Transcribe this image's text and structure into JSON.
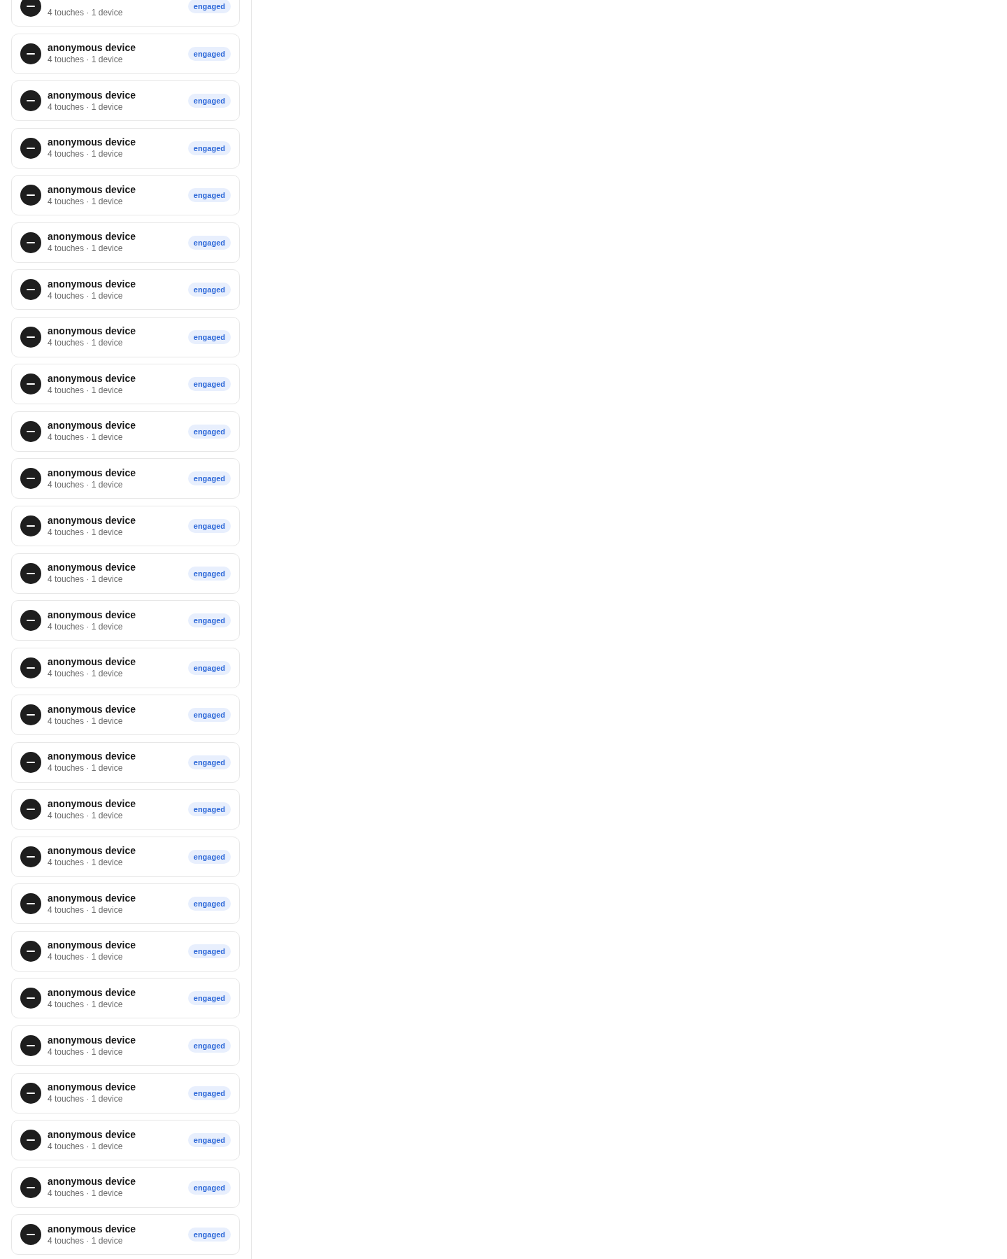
{
  "device_list": {
    "items": [
      {
        "subtitle": "4 touches · 1 device",
        "status": "engaged"
      },
      {
        "title": "anonymous device",
        "subtitle": "4 touches · 1 device",
        "status": "engaged"
      },
      {
        "title": "anonymous device",
        "subtitle": "4 touches · 1 device",
        "status": "engaged"
      },
      {
        "title": "anonymous device",
        "subtitle": "4 touches · 1 device",
        "status": "engaged"
      },
      {
        "title": "anonymous device",
        "subtitle": "4 touches · 1 device",
        "status": "engaged"
      },
      {
        "title": "anonymous device",
        "subtitle": "4 touches · 1 device",
        "status": "engaged"
      },
      {
        "title": "anonymous device",
        "subtitle": "4 touches · 1 device",
        "status": "engaged"
      },
      {
        "title": "anonymous device",
        "subtitle": "4 touches · 1 device",
        "status": "engaged"
      },
      {
        "title": "anonymous device",
        "subtitle": "4 touches · 1 device",
        "status": "engaged"
      },
      {
        "title": "anonymous device",
        "subtitle": "4 touches · 1 device",
        "status": "engaged"
      },
      {
        "title": "anonymous device",
        "subtitle": "4 touches · 1 device",
        "status": "engaged"
      },
      {
        "title": "anonymous device",
        "subtitle": "4 touches · 1 device",
        "status": "engaged"
      },
      {
        "title": "anonymous device",
        "subtitle": "4 touches · 1 device",
        "status": "engaged"
      },
      {
        "title": "anonymous device",
        "subtitle": "4 touches · 1 device",
        "status": "engaged"
      },
      {
        "title": "anonymous device",
        "subtitle": "4 touches · 1 device",
        "status": "engaged"
      },
      {
        "title": "anonymous device",
        "subtitle": "4 touches · 1 device",
        "status": "engaged"
      },
      {
        "title": "anonymous device",
        "subtitle": "4 touches · 1 device",
        "status": "engaged"
      },
      {
        "title": "anonymous device",
        "subtitle": "4 touches · 1 device",
        "status": "engaged"
      },
      {
        "title": "anonymous device",
        "subtitle": "4 touches · 1 device",
        "status": "engaged"
      },
      {
        "title": "anonymous device",
        "subtitle": "4 touches · 1 device",
        "status": "engaged"
      },
      {
        "title": "anonymous device",
        "subtitle": "4 touches · 1 device",
        "status": "engaged"
      },
      {
        "title": "anonymous device",
        "subtitle": "4 touches · 1 device",
        "status": "engaged"
      },
      {
        "title": "anonymous device",
        "subtitle": "4 touches · 1 device",
        "status": "engaged"
      },
      {
        "title": "anonymous device",
        "subtitle": "4 touches · 1 device",
        "status": "engaged"
      },
      {
        "title": "anonymous device",
        "subtitle": "4 touches · 1 device",
        "status": "engaged"
      },
      {
        "title": "anonymous device",
        "subtitle": "4 touches · 1 device",
        "status": "engaged"
      },
      {
        "title": "anonymous device",
        "subtitle": "4 touches · 1 device",
        "status": "engaged"
      }
    ]
  }
}
